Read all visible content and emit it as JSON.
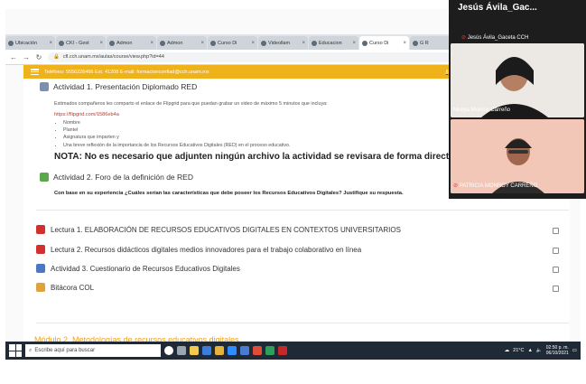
{
  "browser": {
    "tabs": [
      {
        "label": "Ubicación",
        "active": false
      },
      {
        "label": "CKI - Gest",
        "active": false
      },
      {
        "label": "Admon",
        "active": false
      },
      {
        "label": "Admon",
        "active": false
      },
      {
        "label": "Curso Di",
        "active": false
      },
      {
        "label": "Videollam",
        "active": false
      },
      {
        "label": "Educacion",
        "active": false
      },
      {
        "label": "Curso Di",
        "active": true
      },
      {
        "label": "G R",
        "active": false
      }
    ],
    "url": "cfl.cch.unam.mx/aulas/course/view.php?id=44"
  },
  "site_header": {
    "contact": "Teléfono: 5556226466 Ext. 41208  E-mail: formacionconfiad@cch.unam.mx"
  },
  "activity1": {
    "title": "Actividad 1. Presentación Diplomado RED",
    "description": "Estimados compañeros les comparto el enlace de Flipgrid para que puedan grabar un video de máximo 5 minutos que incluya:",
    "link": "https://flipgrid.com/1586eb4a",
    "bullets": [
      "Nombre",
      "Plantel",
      "Asignatura que imparten y",
      "Una breve reflexión de la importancia de los Recursos Educativos Digitales (RED) en el proceso educativo."
    ],
    "note": "NOTA: No es necesario que adjunten ningún archivo la actividad se revisara de forma directa en F"
  },
  "activity2": {
    "title": "Actividad 2. Foro de la definición de RED",
    "question": "Con base en su experiencia ¿Cuáles serían las características que debe poseer los Recursos Educativos Digitales? Justifique su respuesta."
  },
  "items": [
    {
      "label": "Lectura 1. ELABORACIÓN DE RECURSOS EDUCATIVOS DIGITALES EN CONTEXTOS UNIVERSITARIOS",
      "icon": "pdf-icon"
    },
    {
      "label": "Lectura 2. Recursos didácticos digitales medios innovadores para el trabajo colaborativo en línea",
      "icon": "pdf-icon"
    },
    {
      "label": "Actividad 3. Cuestionario de Recursos Educativos Digitales",
      "icon": "quiz-icon"
    },
    {
      "label": "Bitácora COL",
      "icon": "blog-icon"
    }
  ],
  "module_next": "Módulo 2. Metodologías de recursos educativos digitales",
  "taskbar": {
    "search_placeholder": "Escribe aquí para buscar",
    "weather": "21°C",
    "time": "02:50 p. m.",
    "date": "06/10/2021"
  },
  "video_call": {
    "host_name": "Jesús Ávila_Gac...",
    "participants": [
      {
        "name": "Jesús Ávila_Gaceta CCH"
      },
      {
        "name": "Mireya Monroy Carreño"
      },
      {
        "name": "PATRICIA MONROY CARREÑO"
      }
    ]
  },
  "colors": {
    "header_bar": "#f0b21a",
    "link": "#c0392b",
    "module_title": "#f0a020",
    "taskbar": "#1f2a36",
    "video_panel": "#1d1d1d"
  }
}
